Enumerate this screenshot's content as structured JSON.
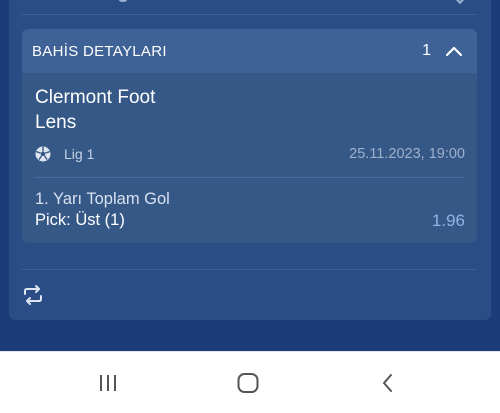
{
  "colors": {
    "background": "#1b3c78",
    "card": "#2a4d86",
    "details_card": "#355887",
    "details_header": "#3e6296",
    "odds": "#8fb3e6"
  },
  "bet_details": {
    "title": "BAHİS DETAYLARI",
    "count": "1",
    "collapse_icon": "chevron-up-icon"
  },
  "match": {
    "home_team": "Clermont Foot",
    "away_team": "Lens",
    "sport_icon": "soccer-ball-icon",
    "league": "Lig 1",
    "datetime": "25.11.2023, 19:00"
  },
  "selection": {
    "market": "1. Yarı Toplam Gol",
    "pick": "Pick: Üst (1)",
    "odds": "1.96"
  },
  "footer": {
    "icon": "repeat-icon"
  },
  "navbar": {
    "recents_icon": "recents-icon",
    "home_icon": "home-icon",
    "back_icon": "back-icon"
  }
}
